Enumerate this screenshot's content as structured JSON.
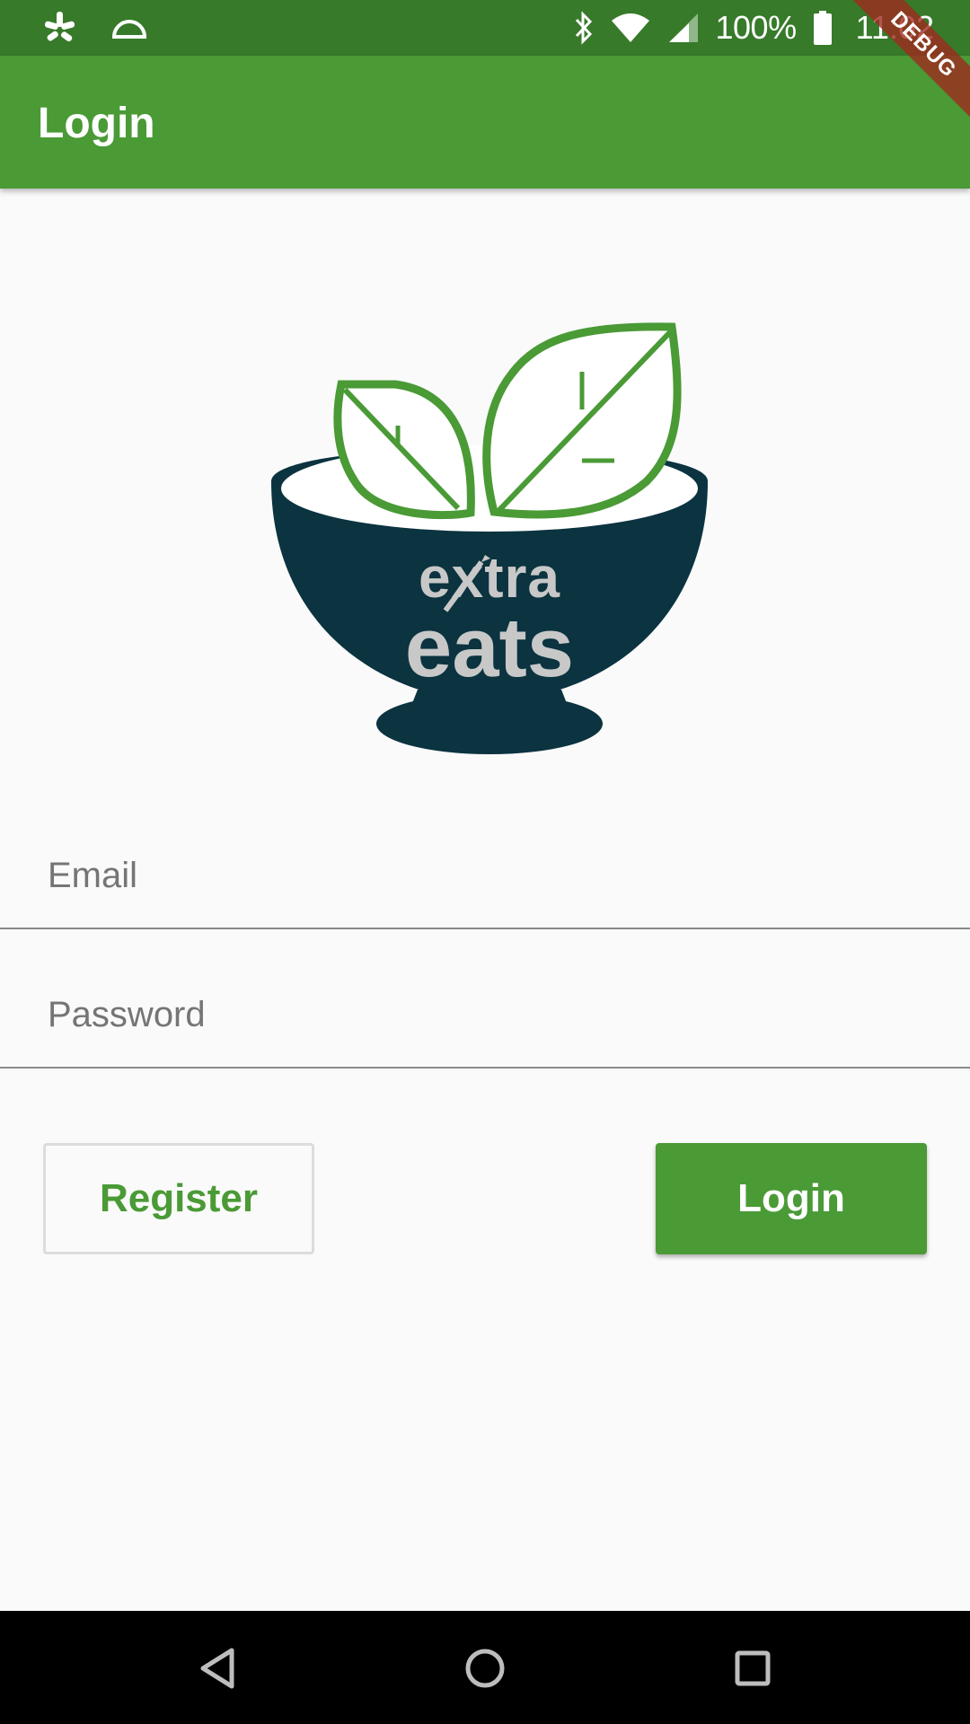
{
  "status_bar": {
    "battery_percent": "100%",
    "time": "11:02",
    "icons": [
      "yelp-icon",
      "cloud-dome-icon",
      "bluetooth-icon",
      "wifi-icon",
      "signal-icon",
      "battery-icon"
    ]
  },
  "debug_banner": "DEBUG",
  "app_bar": {
    "title": "Login"
  },
  "logo": {
    "line1": "extra",
    "line2": "eats"
  },
  "form": {
    "email_placeholder": "Email",
    "password_placeholder": "Password",
    "register_label": "Register",
    "login_label": "Login"
  },
  "nav_bar": {
    "icons": [
      "back-icon",
      "home-icon",
      "recents-icon"
    ]
  },
  "colors": {
    "status_bar": "#377a2a",
    "primary": "#4a9a36",
    "bowl": "#0b3340",
    "logo_text": "#c8c8c8",
    "background": "#fafafa"
  }
}
